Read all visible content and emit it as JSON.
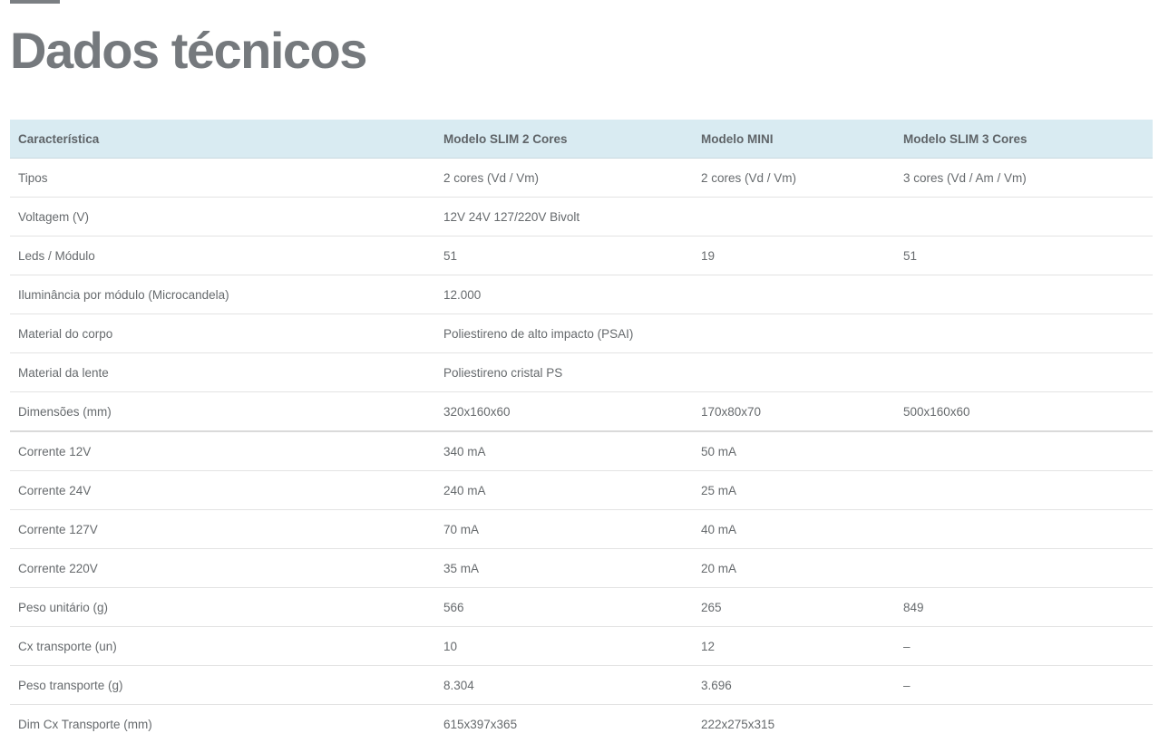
{
  "page": {
    "title": "Dados técnicos"
  },
  "table": {
    "headers": [
      "Característica",
      "Modelo SLIM 2 Cores",
      "Modelo MINI",
      "Modelo SLIM 3 Cores"
    ],
    "rows": [
      [
        "Tipos",
        "2 cores (Vd / Vm)",
        "2 cores (Vd / Vm)",
        "3 cores (Vd / Am / Vm)"
      ],
      [
        "Voltagem (V)",
        "12V 24V 127/220V Bivolt",
        "",
        ""
      ],
      [
        "Leds / Módulo",
        "51",
        "19",
        "51"
      ],
      [
        "Iluminância por módulo (Microcandela)",
        "12.000",
        "",
        ""
      ],
      [
        "Material do corpo",
        "Poliestireno de alto impacto (PSAI)",
        "",
        ""
      ],
      [
        "Material da lente",
        "Poliestireno cristal PS",
        "",
        ""
      ],
      [
        "Dimensões (mm)",
        "320x160x60",
        "170x80x70",
        "500x160x60"
      ],
      [
        "Corrente 12V",
        "340 mA",
        "50 mA",
        ""
      ],
      [
        "Corrente 24V",
        "240 mA",
        "25 mA",
        ""
      ],
      [
        "Corrente 127V",
        "70 mA",
        "40 mA",
        ""
      ],
      [
        "Corrente 220V",
        "35 mA",
        "20 mA",
        ""
      ],
      [
        "Peso unitário (g)",
        "566",
        "265",
        "849"
      ],
      [
        "Cx transporte (un)",
        "10",
        "12",
        "–"
      ],
      [
        "Peso transporte (g)",
        "8.304",
        "3.696",
        "–"
      ],
      [
        "Dim Cx Transporte (mm)",
        "615x397x365",
        "222x275x315",
        ""
      ]
    ]
  },
  "colors": {
    "header_bg": "#d9ebf2",
    "title": "#75797d",
    "text": "#666a6d"
  }
}
